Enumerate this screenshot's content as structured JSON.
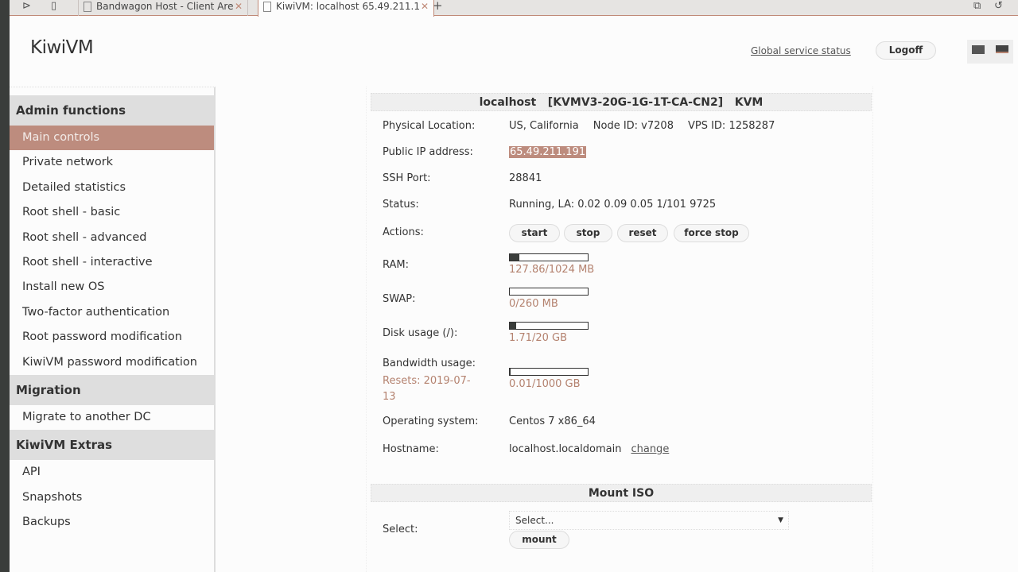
{
  "browser": {
    "tabs": [
      {
        "title": "Bandwagon Host - Client Are",
        "active": false
      },
      {
        "title": "KiwiVM: localhost 65.49.211.1",
        "active": true
      }
    ]
  },
  "header": {
    "logo": "KiwiVM",
    "global_status": "Global service status",
    "logoff": "Logoff"
  },
  "sidebar": {
    "sections": [
      {
        "title": "Admin functions",
        "items": [
          "Main controls",
          "Private network",
          "Detailed statistics",
          "Root shell - basic",
          "Root shell - advanced",
          "Root shell - interactive",
          "Install new OS",
          "Two-factor authentication",
          "Root password modification",
          "KiwiVM password modification"
        ]
      },
      {
        "title": "Migration",
        "items": [
          "Migrate to another DC"
        ]
      },
      {
        "title": "KiwiVM Extras",
        "items": [
          "API",
          "Snapshots",
          "Backups"
        ]
      }
    ],
    "selected": "Main controls"
  },
  "main": {
    "title": "localhost   [KVMV3-20G-1G-1T-CA-CN2]   KVM",
    "location_label": "Physical Location:",
    "location": "US, California",
    "node_id": "Node ID: v7208",
    "vps_id": "VPS ID: 1258287",
    "ip_label": "Public IP address:",
    "ip": "65.49.211.191",
    "ssh_label": "SSH Port:",
    "ssh": "28841",
    "status_label": "Status:",
    "status": "Running, LA: 0.02 0.09 0.05 1/101 9725",
    "actions_label": "Actions:",
    "actions": [
      "start",
      "stop",
      "reset",
      "force stop"
    ],
    "ram": {
      "label": "RAM:",
      "text": "127.86/1024 MB",
      "fraction": 0.125
    },
    "swap": {
      "label": "SWAP:",
      "text": "0/260 MB",
      "fraction": 0
    },
    "disk": {
      "label": "Disk usage (/):",
      "text": "1.71/20 GB",
      "fraction": 0.0855
    },
    "bandwidth": {
      "label": "Bandwidth usage:",
      "resets": "Resets: 2019-07-13",
      "text": "0.01/1000 GB",
      "fraction": 1e-05
    },
    "os_label": "Operating system:",
    "os": "Centos 7 x86_64",
    "hostname_label": "Hostname:",
    "hostname": "localhost.localdomain",
    "change": "change",
    "iso": {
      "title": "Mount ISO",
      "select_label": "Select:",
      "select_value": "Select...",
      "mount": "mount"
    }
  },
  "colors": {
    "accent": "#bd8c7e",
    "bar_fill": "#3a3d3b"
  }
}
